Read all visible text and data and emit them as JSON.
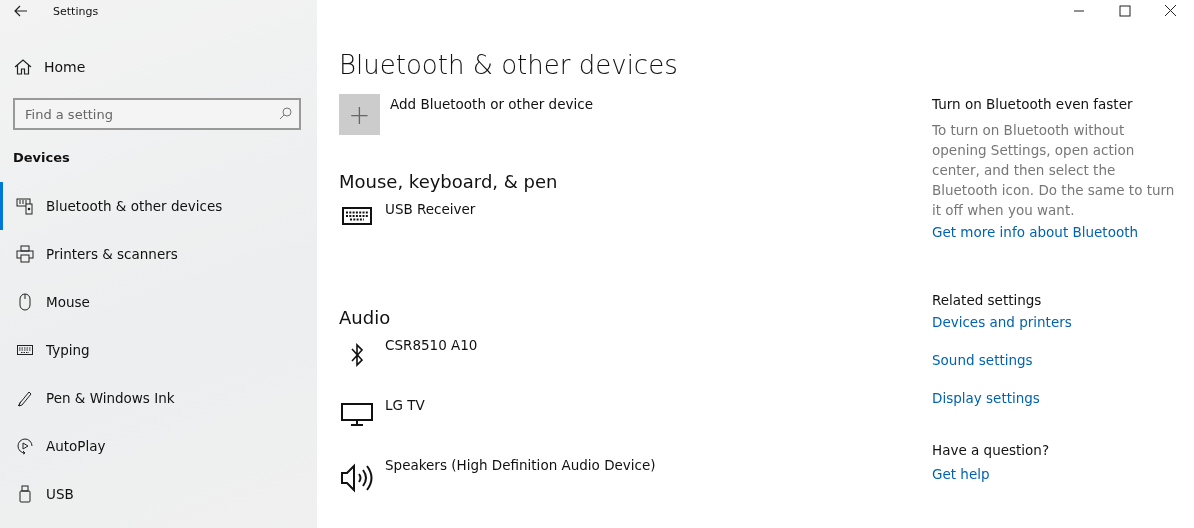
{
  "window": {
    "title": "Settings"
  },
  "sidebar": {
    "home": "Home",
    "search": {
      "placeholder": "Find a setting"
    },
    "section": "Devices",
    "items": [
      {
        "label": "Bluetooth & other devices",
        "kind": "devices",
        "selected": true
      },
      {
        "label": "Printers & scanners",
        "kind": "printer",
        "selected": false
      },
      {
        "label": "Mouse",
        "kind": "mouse",
        "selected": false
      },
      {
        "label": "Typing",
        "kind": "keyboard",
        "selected": false
      },
      {
        "label": "Pen & Windows Ink",
        "kind": "pen",
        "selected": false
      },
      {
        "label": "AutoPlay",
        "kind": "autoplay",
        "selected": false
      },
      {
        "label": "USB",
        "kind": "usb",
        "selected": false
      }
    ]
  },
  "main": {
    "title": "Bluetooth & other devices",
    "add_button": {
      "icon": "+",
      "label": "Add Bluetooth or other device"
    },
    "groups": [
      {
        "heading": "Mouse, keyboard, & pen",
        "devices": [
          {
            "name": "USB Receiver",
            "kind": "keyboard"
          }
        ]
      },
      {
        "heading": "Audio",
        "devices": [
          {
            "name": "CSR8510 A10",
            "kind": "bluetooth"
          },
          {
            "name": "LG TV",
            "kind": "monitor"
          },
          {
            "name": "Speakers (High Definition Audio Device)",
            "kind": "speaker"
          }
        ]
      }
    ]
  },
  "aside": {
    "tip": {
      "heading": "Turn on Bluetooth even faster",
      "text": "To turn on Bluetooth without opening Settings, open action center, and then select the Bluetooth icon. Do the same to turn it off when you want.",
      "link": "Get more info about Bluetooth"
    },
    "related": {
      "heading": "Related settings",
      "links": [
        "Devices and printers",
        "Sound settings",
        "Display settings"
      ]
    },
    "help": {
      "heading": "Have a question?",
      "link": "Get help"
    }
  }
}
